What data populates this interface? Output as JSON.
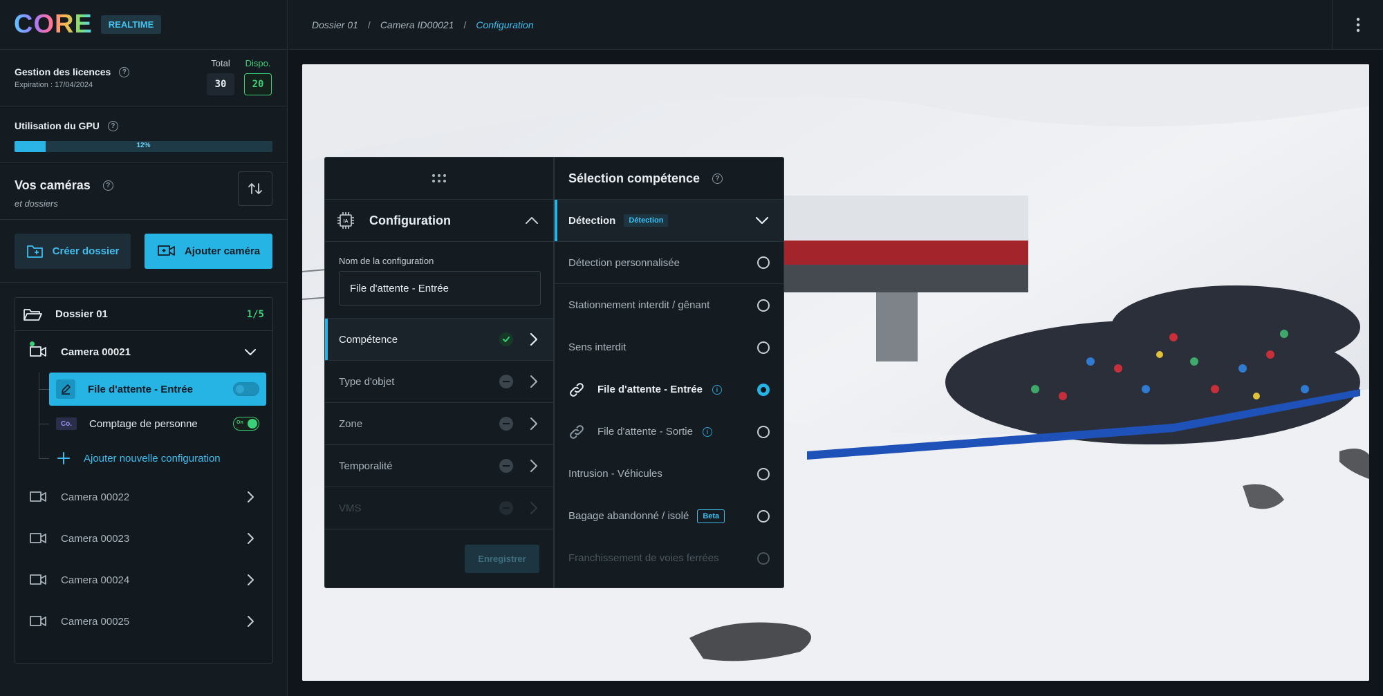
{
  "brand": {
    "logo": "CORE",
    "badge": "REALTIME"
  },
  "licenses": {
    "title": "Gestion des licences",
    "expiration": "Expiration : 17/04/2024",
    "total_label": "Total",
    "total_value": "30",
    "dispo_label": "Dispo.",
    "dispo_value": "20"
  },
  "gpu": {
    "title": "Utilisation du GPU",
    "percent": 12,
    "percent_label": "12%"
  },
  "cameras_section": {
    "title": "Vos caméras",
    "subtitle": "et dossiers"
  },
  "actions": {
    "create_folder": "Créer dossier",
    "add_camera": "Ajouter caméra"
  },
  "folder": {
    "name": "Dossier 01",
    "count": "1/5",
    "active_camera": "Camera 00021",
    "configs": [
      {
        "label": "File d'attente - Entrée",
        "enabled": false
      },
      {
        "label": "Comptage de personne",
        "badge": "Co.",
        "toggle_text": "On",
        "enabled": true
      }
    ],
    "add_config": "Ajouter nouvelle configuration",
    "other_cameras": [
      "Camera 00022",
      "Camera 00023",
      "Camera 00024",
      "Camera 00025"
    ]
  },
  "breadcrumb": {
    "items": [
      "Dossier 01",
      "Camera ID00021",
      "Configuration"
    ]
  },
  "config_panel": {
    "title": "Configuration",
    "chip_icon_text": "IA",
    "name_label": "Nom de la configuration",
    "name_value": "File d'attente - Entrée",
    "steps": [
      {
        "label": "Compétence",
        "status": "done"
      },
      {
        "label": "Type d'objet",
        "status": "pending"
      },
      {
        "label": "Zone",
        "status": "pending"
      },
      {
        "label": "Temporalité",
        "status": "pending"
      },
      {
        "label": "VMS",
        "status": "disabled"
      }
    ],
    "save": "Enregistrer"
  },
  "skill_panel": {
    "title": "Sélection compétence",
    "category": "Détection",
    "category_tag": "Détection",
    "options": [
      {
        "label": "Détection personnalisée"
      },
      {
        "label": "Stationnement interdit / gênant"
      },
      {
        "label": "Sens interdit"
      },
      {
        "label": "File d'attente - Entrée",
        "selected": true
      },
      {
        "label": "File d'attente - Sortie"
      },
      {
        "label": "Intrusion - Véhicules"
      },
      {
        "label": "Bagage abandonné / isolé",
        "badge": "Beta"
      },
      {
        "label": "Franchissement de voies ferrées",
        "disabled": true
      }
    ]
  },
  "colors": {
    "accent": "#26b4e5",
    "success": "#3ccf7a",
    "panel": "#151c21",
    "background": "#0f151a"
  }
}
